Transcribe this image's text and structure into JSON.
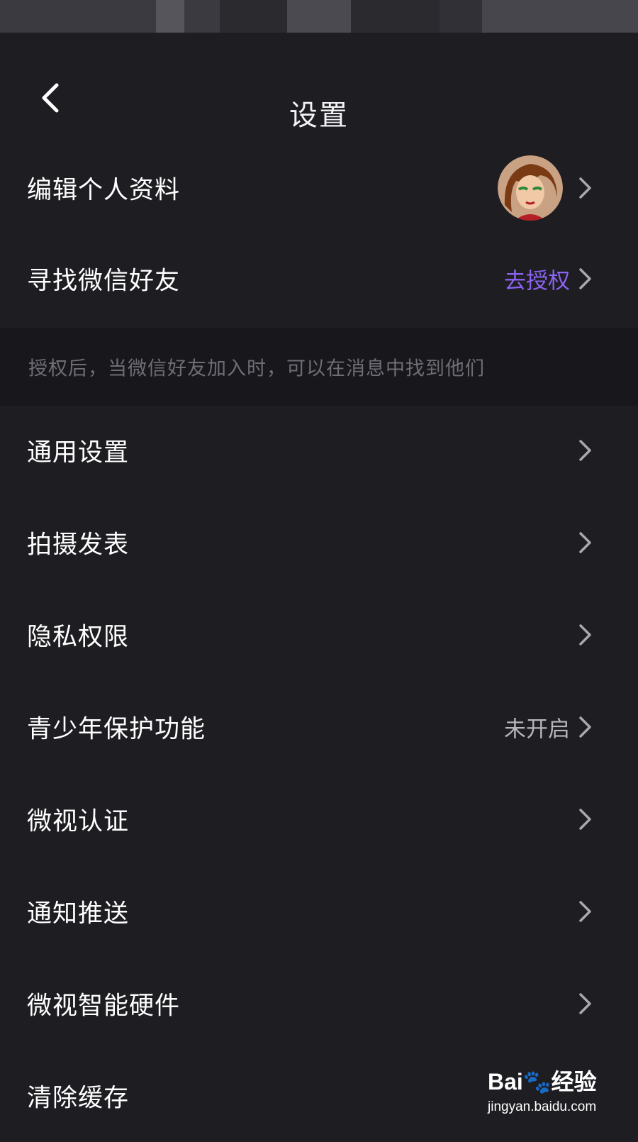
{
  "header": {
    "title": "设置",
    "back_icon": "chevron-left-icon"
  },
  "rows": [
    {
      "label": "编辑个人资料",
      "trailing": "avatar"
    },
    {
      "label": "寻找微信好友",
      "value": "去授权",
      "value_color": "#8b63f2"
    },
    {
      "label": "通用设置"
    },
    {
      "label": "拍摄发表"
    },
    {
      "label": "隐私权限"
    },
    {
      "label": "青少年保护功能",
      "value": "未开启"
    },
    {
      "label": "微视认证"
    },
    {
      "label": "通知推送"
    },
    {
      "label": "微视智能硬件"
    },
    {
      "label": "清除缓存"
    }
  ],
  "wechat_tip": "授权后，当微信好友加入时，可以在消息中找到他们",
  "watermark": {
    "brand": "Bai🐾经验",
    "url": "jingyan.baidu.com"
  },
  "colors": {
    "background": "#1e1d22",
    "tip_band": "#18171c",
    "accent": "#8b63f2",
    "secondary_text": "#b6b5bb"
  }
}
